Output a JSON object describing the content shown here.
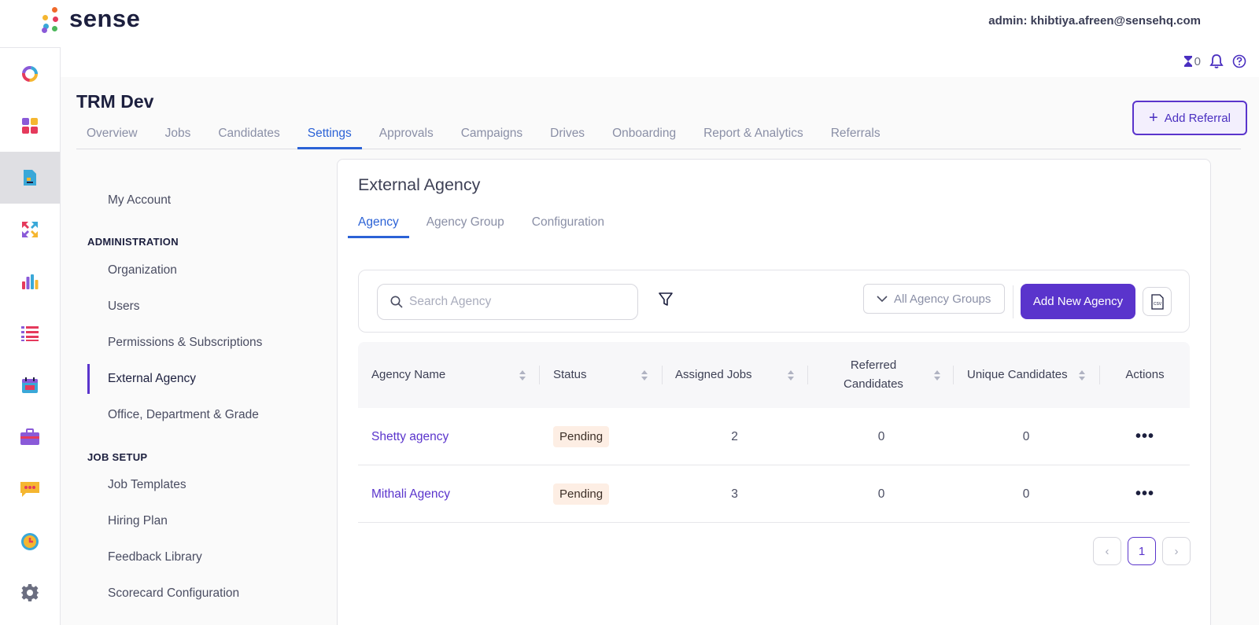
{
  "header": {
    "brand": "sense",
    "admin_label": "admin: khibtiya.afreen@sensehq.com"
  },
  "utility": {
    "hourglass_count": "0"
  },
  "page": {
    "title": "TRM Dev",
    "add_referral_label": "Add Referral"
  },
  "tabs": [
    {
      "label": "Overview"
    },
    {
      "label": "Jobs"
    },
    {
      "label": "Candidates"
    },
    {
      "label": "Settings",
      "active": true
    },
    {
      "label": "Approvals"
    },
    {
      "label": "Campaigns"
    },
    {
      "label": "Drives"
    },
    {
      "label": "Onboarding"
    },
    {
      "label": "Report & Analytics"
    },
    {
      "label": "Referrals"
    }
  ],
  "settings_menu": {
    "my_account": "My Account",
    "administration_heading": "ADMINISTRATION",
    "administration_items": [
      "Organization",
      "Users",
      "Permissions & Subscriptions",
      "External Agency",
      "Office, Department & Grade"
    ],
    "job_setup_heading": "JOB SETUP",
    "job_setup_items": [
      "Job Templates",
      "Hiring Plan",
      "Feedback Library",
      "Scorecard Configuration"
    ]
  },
  "content": {
    "title": "External Agency",
    "sub_tabs": [
      "Agency",
      "Agency Group",
      "Configuration"
    ],
    "search_placeholder": "Search Agency",
    "group_select_value": "All Agency Groups",
    "add_new_label": "Add New Agency",
    "csv_label": "CSV"
  },
  "table": {
    "headers": [
      "Agency Name",
      "Status",
      "Assigned Jobs",
      "Referred Candidates",
      "Unique Candidates",
      "Actions"
    ],
    "rows": [
      {
        "name": "Shetty agency",
        "status": "Pending",
        "assigned_jobs": "2",
        "referred": "0",
        "unique": "0",
        "actions": "•••"
      },
      {
        "name": "Mithali Agency",
        "status": "Pending",
        "assigned_jobs": "3",
        "referred": "0",
        "unique": "0",
        "actions": "•••"
      }
    ]
  },
  "pagination": {
    "prev": "‹",
    "current": "1",
    "next": "›"
  },
  "colors": {
    "accent": "#5a34cc",
    "tab_active": "#2b62d6",
    "badge_bg": "#fdeee4"
  }
}
